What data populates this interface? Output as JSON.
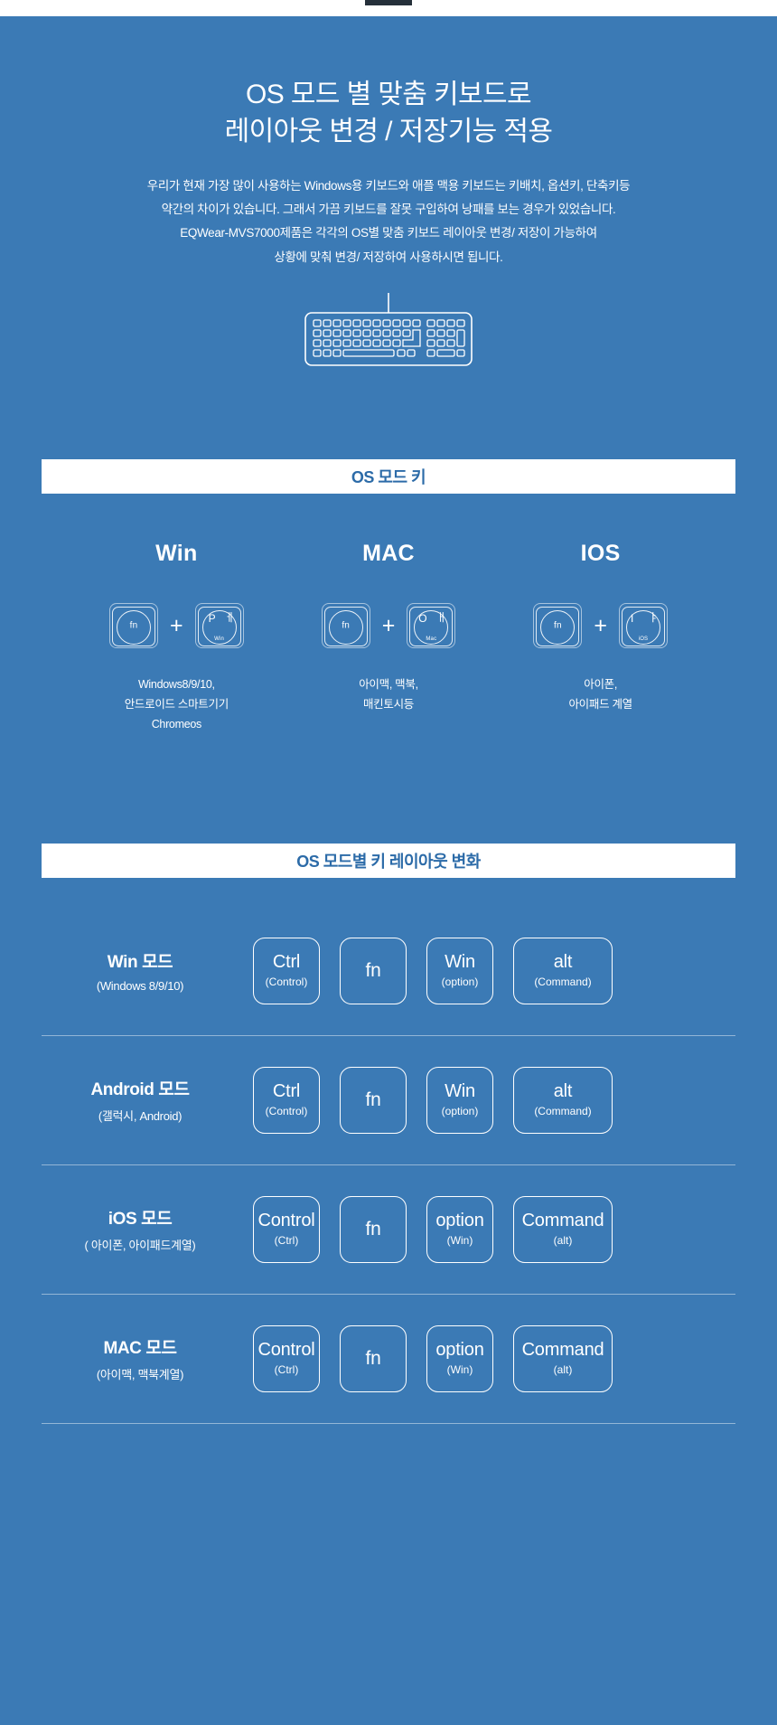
{
  "theme": {
    "background": "#3b7ab5",
    "text": "#ffffff",
    "banner_bg": "#ffffff",
    "banner_text": "#2c6ba8"
  },
  "hero": {
    "title_line1": "OS 모드 별 맞춤 키보드로",
    "title_line2": "레이아웃 변경 / 저장기능 적용",
    "paragraph": [
      "우리가 현재 가장 많이 사용하는 Windows용 키보드와 애플 맥용 키보드는 키배치, 옵션키, 단축키등",
      "약간의 차이가 있습니다. 그래서 가끔 키보드를 잘못 구입하여 낭패를 보는 경우가 있었습니다.",
      "EQWear-MVS7000제품은 각각의 OS별 맞춤 키보드 레이아웃 변경/ 저장이 가능하여",
      "상황에 맞춰 변경/ 저장하여 사용하시면 됩니다."
    ],
    "keyboard_icon": "keyboard-illustration-icon"
  },
  "section1": {
    "banner": "OS 모드 키",
    "columns": [
      {
        "name": "Win",
        "key1": {
          "label": "fn",
          "icon": "fn-keycap-icon"
        },
        "operator": "+",
        "key2": {
          "latin": "P",
          "hangul": "ㅔ",
          "sub": "Win",
          "icon": "win-keycap-icon"
        },
        "desc": [
          "Windows8/9/10,",
          "안드로이드 스마트기기",
          "Chromeos"
        ]
      },
      {
        "name": "MAC",
        "key1": {
          "label": "fn",
          "icon": "fn-keycap-icon"
        },
        "operator": "+",
        "key2": {
          "latin": "O",
          "hangul": "ㅐ",
          "sub": "Mac",
          "icon": "mac-keycap-icon"
        },
        "desc": [
          "아이맥, 맥북,",
          "매킨토시등"
        ]
      },
      {
        "name": "IOS",
        "key1": {
          "label": "fn",
          "icon": "fn-keycap-icon"
        },
        "operator": "+",
        "key2": {
          "latin": "I",
          "hangul": "ㅑ",
          "sub": "iOS",
          "icon": "ios-keycap-icon"
        },
        "desc": [
          "아이폰,",
          "아이패드 계열"
        ]
      }
    ]
  },
  "section2": {
    "banner": "OS 모드별 키 레이아웃 변화",
    "rows": [
      {
        "mode": "Win 모드",
        "devices": "(Windows 8/9/10)",
        "keys": [
          {
            "main": "Ctrl",
            "alt": "(Control)"
          },
          {
            "main": "fn",
            "alt": ""
          },
          {
            "main": "Win",
            "alt": "(option)"
          },
          {
            "main": "alt",
            "alt": "(Command)"
          }
        ]
      },
      {
        "mode": "Android 모드",
        "devices": "(갤럭시, Android)",
        "keys": [
          {
            "main": "Ctrl",
            "alt": "(Control)"
          },
          {
            "main": "fn",
            "alt": ""
          },
          {
            "main": "Win",
            "alt": "(option)"
          },
          {
            "main": "alt",
            "alt": "(Command)"
          }
        ]
      },
      {
        "mode": "iOS 모드",
        "devices": "( 아이폰, 아이패드계열)",
        "keys": [
          {
            "main": "Control",
            "alt": "(Ctrl)"
          },
          {
            "main": "fn",
            "alt": ""
          },
          {
            "main": "option",
            "alt": "(Win)"
          },
          {
            "main": "Command",
            "alt": "(alt)"
          }
        ]
      },
      {
        "mode": "MAC 모드",
        "devices": "(아이맥, 맥북계열)",
        "keys": [
          {
            "main": "Control",
            "alt": "(Ctrl)"
          },
          {
            "main": "fn",
            "alt": ""
          },
          {
            "main": "option",
            "alt": "(Win)"
          },
          {
            "main": "Command",
            "alt": "(alt)"
          }
        ]
      }
    ]
  }
}
